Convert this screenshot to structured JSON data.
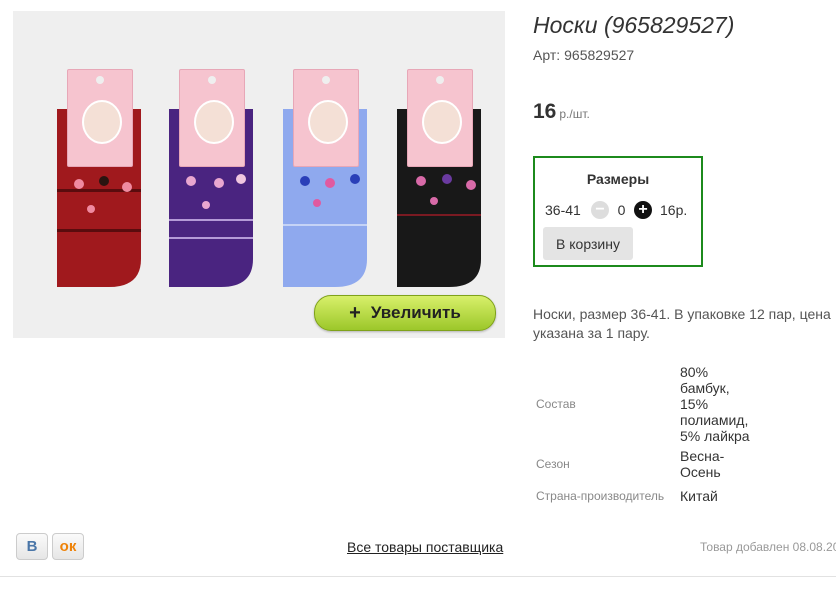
{
  "product": {
    "title": "Носки (965829527)",
    "sku_label": "Арт:",
    "sku_value": "965829527",
    "price": "16",
    "price_unit": "р./шт.",
    "zoom_label": "Увеличить",
    "zoom_plus": "+",
    "sock_colors": [
      "#a0191d",
      "#4a2480",
      "#8fa9ee",
      "#181818"
    ]
  },
  "sizes": {
    "title": "Размеры",
    "rows": [
      {
        "size": "36-41",
        "minus": "−",
        "qty": "0",
        "plus": "+",
        "price": "16р."
      }
    ],
    "cart_label": "В корзину"
  },
  "description": "Носки, размер 36-41. В упаковке 12 пар, цена указана за 1 пару.",
  "attributes": [
    {
      "label": "Состав",
      "value": "80% бамбук, 15% полиамид, 5% лайкра"
    },
    {
      "label": "Сезон",
      "value": "Весна-Осень"
    },
    {
      "label": "Страна-производитель",
      "value": "Китай"
    }
  ],
  "social": {
    "vk": "В",
    "ok": "ок"
  },
  "supplier_link": "Все товары поставщика",
  "added_date": "Товар добавлен 08.08.20"
}
